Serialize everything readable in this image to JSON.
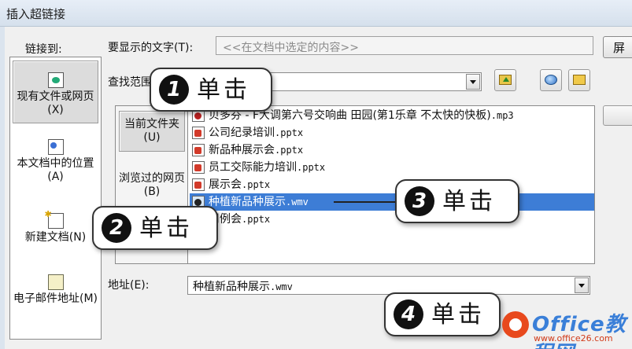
{
  "window": {
    "title": "插入超链接"
  },
  "link_to": {
    "label": "链接到:",
    "items": [
      {
        "label": "现有文件或网页(X)",
        "icon": "web-page-icon"
      },
      {
        "label": "本文档中的位置(A)",
        "icon": "document-place-icon"
      },
      {
        "label": "新建文档(N)",
        "icon": "new-document-icon"
      },
      {
        "label": "电子邮件地址(M)",
        "icon": "email-icon"
      }
    ]
  },
  "text_to_display": {
    "label": "要显示的文字(T):",
    "value": "<<在文档中选定的内容>>"
  },
  "screen_tip_button": "屏",
  "look_in": {
    "label": "查找范围"
  },
  "inner_tabs": [
    {
      "label": "当前文件夹(U)"
    },
    {
      "label": "浏览过的网页(B)"
    }
  ],
  "files": [
    {
      "name": "贝多芬 - F大调第六号交响曲 田园(第1乐章 不太快的快板)",
      "ext": ".mp3",
      "type": "mp3"
    },
    {
      "name": "公司纪录培训",
      "ext": ".pptx",
      "type": "pptx"
    },
    {
      "name": "新品种展示会",
      "ext": ".pptx",
      "type": "pptx"
    },
    {
      "name": "员工交际能力培训",
      "ext": ".pptx",
      "type": "pptx"
    },
    {
      "name": "展示会",
      "ext": ".pptx",
      "type": "pptx"
    },
    {
      "name": "种植新品种展示",
      "ext": ".wmv",
      "type": "wmv",
      "selected": true
    },
    {
      "name": "周例会",
      "ext": ".pptx",
      "type": "pptx"
    }
  ],
  "address": {
    "label": "地址(E):",
    "name": "种植新品种展示",
    "ext": ".wmv"
  },
  "callouts": [
    {
      "num": "1",
      "label": "单击"
    },
    {
      "num": "2",
      "label": "单击"
    },
    {
      "num": "3",
      "label": "单击"
    },
    {
      "num": "4",
      "label": "单击"
    }
  ],
  "watermark": {
    "brand": "Office教程网",
    "url": "www.office26.com"
  },
  "colors": {
    "selection": "#3d7dd6",
    "brand": "#e8491d"
  }
}
